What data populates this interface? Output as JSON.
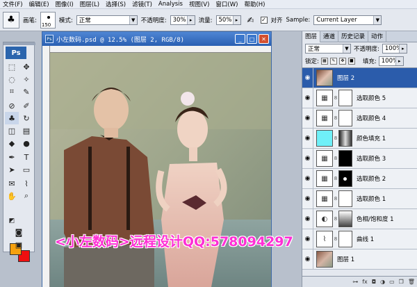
{
  "menubar": {
    "items": [
      "文件(F)",
      "编辑(E)",
      "图像(I)",
      "图层(L)",
      "选择(S)",
      "滤镜(T)",
      "Analysis",
      "视图(V)",
      "窗口(W)",
      "帮助(H)"
    ]
  },
  "options": {
    "brush_label": "画笔:",
    "brush_size": "150",
    "mode_label": "模式:",
    "mode_value": "正常",
    "opacity_label": "不透明度:",
    "opacity_value": "30%",
    "flow_label": "流量:",
    "flow_value": "50%",
    "align_label": "对齐",
    "sample_label": "Sample:",
    "sample_value": "Current Layer"
  },
  "tools": {
    "ps_logo": "Ps",
    "fg_color": "#f6a10f",
    "bg_color": "#ef0f0f"
  },
  "document": {
    "title": "小左数码.psd @ 12.5% (图层 2, RGB/8)"
  },
  "panels": {
    "tabs": [
      "图层",
      "通道",
      "历史记录",
      "动作"
    ],
    "blend_mode": "正常",
    "opacity_label": "不透明度:",
    "opacity_value": "100%",
    "lock_label": "锁定:",
    "fill_label": "填充:",
    "fill_value": "100%",
    "layers": [
      {
        "name": "图层 2",
        "type": "photo",
        "selected": true
      },
      {
        "name": "选取颜色 5",
        "type": "adjust",
        "mask": "white"
      },
      {
        "name": "选取颜色 4",
        "type": "adjust",
        "mask": "white"
      },
      {
        "name": "颜色填充 1",
        "type": "fill",
        "mask": "photo",
        "color": "#6ff0f8"
      },
      {
        "name": "选取颜色 3",
        "type": "adjust",
        "mask": "black"
      },
      {
        "name": "选取颜色 2",
        "type": "adjust",
        "mask": "blackdot"
      },
      {
        "name": "选取颜色 1",
        "type": "adjust",
        "mask": "white"
      },
      {
        "name": "色相/饱和度 1",
        "type": "adjust",
        "mask": "gradient"
      },
      {
        "name": "曲线 1",
        "type": "adjust",
        "mask": "white"
      },
      {
        "name": "图层 1",
        "type": "photo"
      }
    ]
  },
  "watermark": "<小左数码>远程设计QQ:578094297"
}
